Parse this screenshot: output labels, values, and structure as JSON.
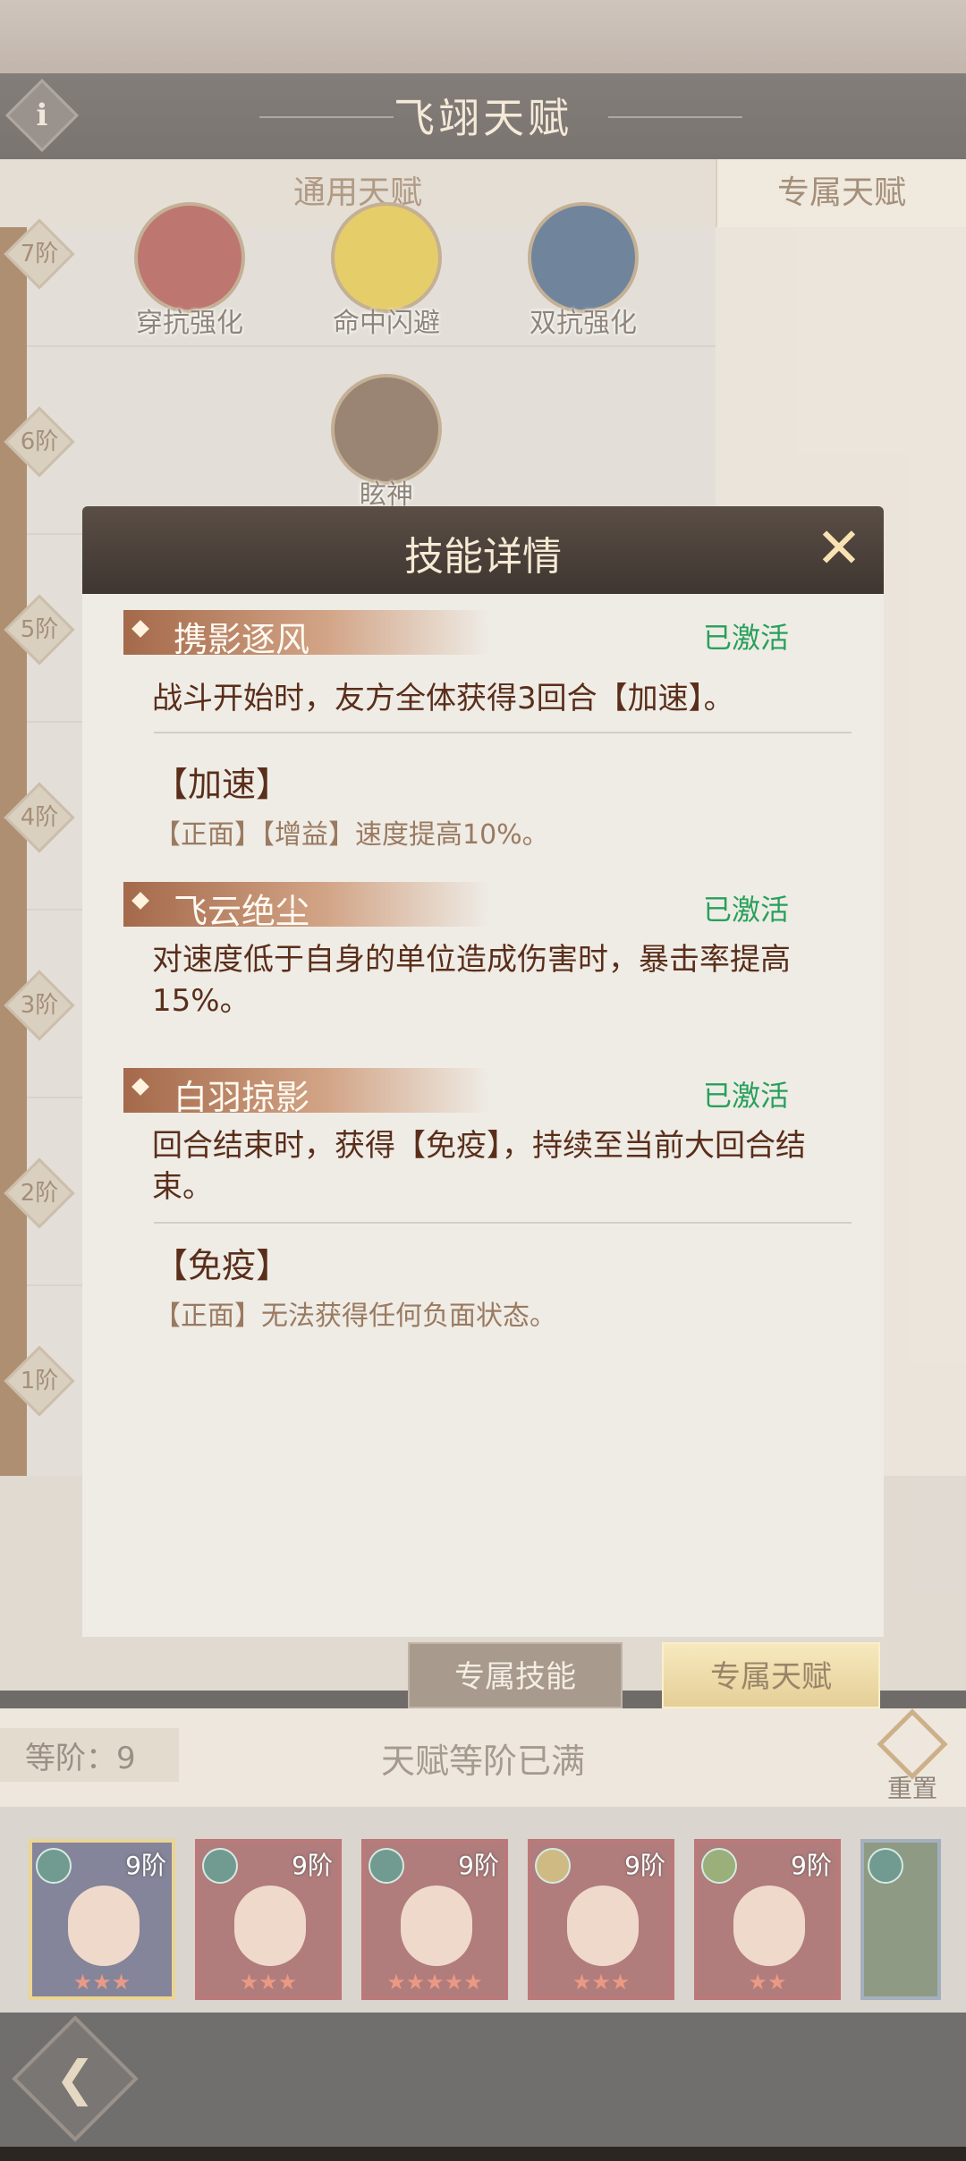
{
  "header": {
    "title": "飞翊天赋",
    "info_icon": "i"
  },
  "tabs": {
    "general": "通用天赋",
    "exclusive": "专属天赋"
  },
  "tiers": [
    "7阶",
    "6阶",
    "5阶",
    "4阶",
    "3阶",
    "2阶",
    "1阶"
  ],
  "talents": [
    {
      "label": "穿抗强化",
      "color": "#a0362e"
    },
    {
      "label": "命中闪避",
      "color": "#d9b522"
    },
    {
      "label": "双抗强化",
      "color": "#2d4b6e"
    },
    {
      "label": "眩神",
      "color": "#6b4b32"
    }
  ],
  "modal": {
    "title": "技能详情",
    "close_icon": "✕",
    "skills": [
      {
        "name": "携影逐风",
        "status": "已激活",
        "desc": "战斗开始时，友方全体获得3回合【加速】。",
        "buff": {
          "name": "【加速】",
          "desc": "【正面】【增益】速度提高10%。"
        }
      },
      {
        "name": "飞云绝尘",
        "status": "已激活",
        "desc": "对速度低于自身的单位造成伤害时，暴击率提高15%。"
      },
      {
        "name": "白羽掠影",
        "status": "已激活",
        "desc": "回合结束时，获得【免疫】，持续至当前大回合结束。",
        "buff": {
          "name": "【免疫】",
          "desc": "【正面】无法获得任何负面状态。"
        }
      }
    ]
  },
  "bottom_buttons": {
    "skill": "专属技能",
    "talent": "专属天赋"
  },
  "status": {
    "level_label": "等阶：",
    "level_value": "9",
    "full": "天赋等阶已满",
    "reset": "重置"
  },
  "heroes": [
    {
      "tag": "9阶",
      "stars": "★★★"
    },
    {
      "tag": "9阶",
      "stars": "★★★"
    },
    {
      "tag": "9阶",
      "stars": "★★★★★"
    },
    {
      "tag": "9阶",
      "stars": "★★★"
    },
    {
      "tag": "9阶",
      "stars": "★★"
    }
  ],
  "nav": {
    "back_icon": "❮"
  }
}
